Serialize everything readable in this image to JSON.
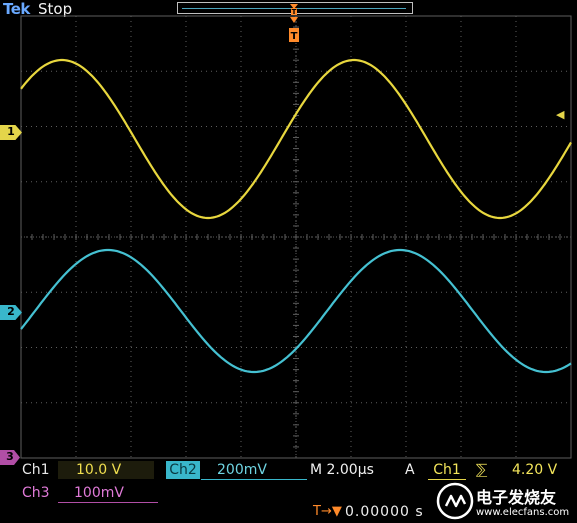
{
  "scope": {
    "brand": "Tek",
    "acquisition_state": "Stop",
    "trigger_marker_glyph": "T",
    "channel_markers": [
      "1",
      "2",
      "3"
    ],
    "ch1": {
      "name": "Ch1",
      "scale": "10.0 V",
      "color": "#e4d54a"
    },
    "ch2": {
      "name": "Ch2",
      "scale": "200mV",
      "color": "#39b7cb"
    },
    "ch3": {
      "name": "Ch3",
      "scale": "100mV",
      "color": "#b14ea6"
    },
    "timebase": "M 2.00µs",
    "trigger": {
      "mode": "A",
      "source": "Ch1",
      "slope_glyph": "⅀",
      "level": "4.20 V",
      "position_glyph": "T→▼",
      "position": "0.00000 s"
    },
    "trigger_level_marker": "◀"
  },
  "watermark": {
    "cn": "电子发烧友",
    "url": "www.elecfans.com"
  },
  "colors": {
    "background": "#000000",
    "grid": "#5e5e5e",
    "ch1_trace": "#e8d73e",
    "ch2_trace": "#45c1d2",
    "brand": "#6aa9ff",
    "trigger_orange": "#ff8a2a"
  }
}
